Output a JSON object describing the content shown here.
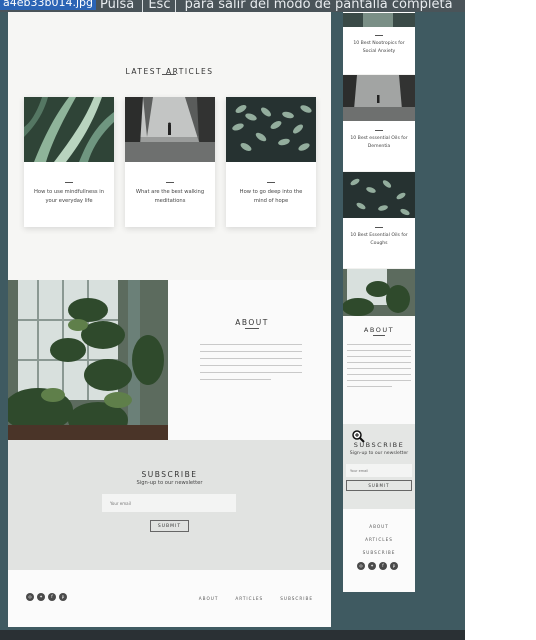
{
  "viewer": {
    "filename": "a4eb33b014.jpg",
    "hint_before": "Pulsa",
    "hint_key": "Esc",
    "hint_after": "para salir del modo de pantalla completa"
  },
  "desktop": {
    "latest_title": "LATEST ARTICLES",
    "cards": [
      {
        "title": "How to use mindfullness in your everyday life",
        "image": "green-leaves-photo"
      },
      {
        "title": "What are the best walking meditations",
        "image": "misty-forest-walker-photo"
      },
      {
        "title": "How to go deep into the mind of hope",
        "image": "leafy-branches-photo"
      }
    ],
    "about_title": "ABOUT",
    "subscribe_title": "SUBSCRIBE",
    "subscribe_line": "Sign-up to our newsletter",
    "email_placeholder": "Your email",
    "submit_label": "SUBMIT",
    "footer_links": [
      "ABOUT",
      "ARTICLES",
      "SUBSCRIBE"
    ],
    "social_icons": [
      "instagram-icon",
      "twitter-icon",
      "facebook-icon",
      "pinterest-icon"
    ]
  },
  "mobile": {
    "cards": [
      {
        "title": "10 Best Nootropics for Social Anxiety"
      },
      {
        "title": "10 Best essential Oils for Dementia"
      },
      {
        "title": "10 Best Essential Oils for Coughs"
      }
    ],
    "about_title": "ABOUT",
    "subscribe_title": "SUBSCRIBE",
    "subscribe_line": "Sign-up to our newsletter",
    "email_placeholder": "Your email",
    "submit_label": "SUBMIT",
    "footer_links": [
      "ABOUT",
      "ARTICLES",
      "SUBSCRIBE"
    ]
  }
}
